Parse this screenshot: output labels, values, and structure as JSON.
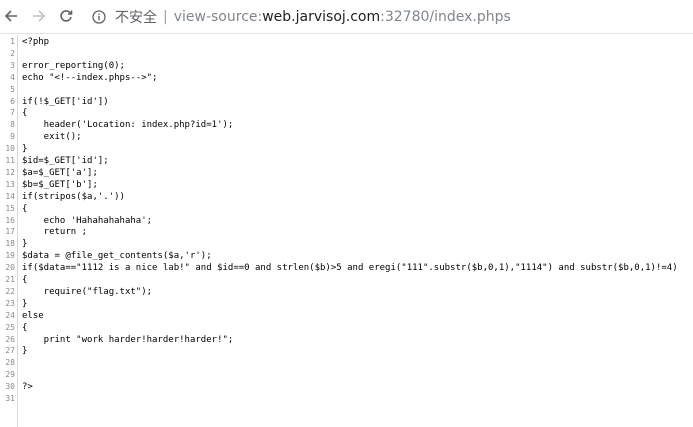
{
  "toolbar": {
    "security_label": "不安全",
    "separator": "|",
    "url_prefix": "view-source:",
    "url_host": "web.jarvisoj.com",
    "url_rest": ":32780/index.phps"
  },
  "source_lines": [
    {
      "n": "1",
      "text": "<?php"
    },
    {
      "n": "2",
      "text": ""
    },
    {
      "n": "3",
      "text": "error_reporting(0);"
    },
    {
      "n": "4",
      "text": "echo \"<!--index.phps-->\";"
    },
    {
      "n": "5",
      "text": ""
    },
    {
      "n": "6",
      "text": "if(!$_GET['id'])"
    },
    {
      "n": "7",
      "text": "{"
    },
    {
      "n": "8",
      "text": "    header('Location: index.php?id=1');"
    },
    {
      "n": "9",
      "text": "    exit();"
    },
    {
      "n": "10",
      "text": "}"
    },
    {
      "n": "11",
      "text": "$id=$_GET['id'];"
    },
    {
      "n": "12",
      "text": "$a=$_GET['a'];"
    },
    {
      "n": "13",
      "text": "$b=$_GET['b'];"
    },
    {
      "n": "14",
      "text": "if(stripos($a,'.'))"
    },
    {
      "n": "15",
      "text": "{"
    },
    {
      "n": "16",
      "text": "    echo 'Hahahahahaha';"
    },
    {
      "n": "17",
      "text": "    return ;"
    },
    {
      "n": "18",
      "text": "}"
    },
    {
      "n": "19",
      "text": "$data = @file_get_contents($a,'r');"
    },
    {
      "n": "20",
      "text": "if($data==\"1112 is a nice lab!\" and $id==0 and strlen($b)>5 and eregi(\"111\".substr($b,0,1),\"1114\") and substr($b,0,1)!=4)"
    },
    {
      "n": "21",
      "text": "{"
    },
    {
      "n": "22",
      "text": "    require(\"flag.txt\");"
    },
    {
      "n": "23",
      "text": "}"
    },
    {
      "n": "24",
      "text": "else"
    },
    {
      "n": "25",
      "text": "{"
    },
    {
      "n": "26",
      "text": "    print \"work harder!harder!harder!\";"
    },
    {
      "n": "27",
      "text": "}"
    },
    {
      "n": "28",
      "text": ""
    },
    {
      "n": "29",
      "text": ""
    },
    {
      "n": "30",
      "text": "?>"
    },
    {
      "n": "31",
      "text": ""
    }
  ]
}
